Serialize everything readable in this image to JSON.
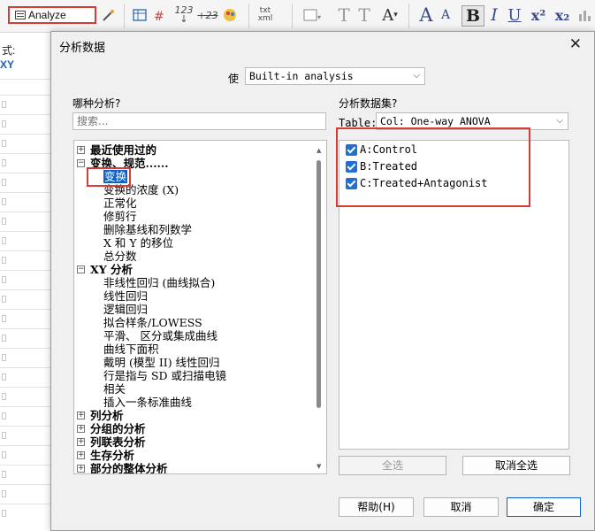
{
  "toolbar": {
    "analyze_label": "Analyze",
    "tool_glyphs": {
      "superscript": "x²",
      "subscript": "x₂",
      "numbers": "123",
      "numbers2": "+23",
      "bold": "B",
      "italic": "I",
      "underline": "U",
      "big_a": "A",
      "small_a": "A",
      "t1": "T",
      "t2": "T",
      "text_menu": "A",
      "txt_xml": "txt xml"
    }
  },
  "sheet": {
    "format_label": "式:",
    "xy_label": "XY"
  },
  "dialog": {
    "title": "分析数据",
    "close_glyph": "✕",
    "use_label": "使",
    "analysis_source": {
      "value": "Built-in analysis",
      "arrow": "⌵"
    },
    "which_analysis_label": "哪种分析?",
    "search": {
      "placeholder": "搜索..."
    },
    "tree": [
      {
        "label": "最近使用过的",
        "expander": "+"
      },
      {
        "label": "变换、规范......",
        "expander": "−"
      },
      {
        "label": "变换",
        "selected": true
      },
      {
        "label": "变换的浓度 (X)"
      },
      {
        "label": "正常化"
      },
      {
        "label": "修剪行"
      },
      {
        "label": "删除基线和列数学"
      },
      {
        "label": "X 和 Y 的移位"
      },
      {
        "label": "总分数"
      },
      {
        "label": "XY 分析",
        "expander": "−"
      },
      {
        "label": "非线性回归 (曲线拟合)"
      },
      {
        "label": "线性回归"
      },
      {
        "label": "逻辑回归"
      },
      {
        "label": "拟合样条/LOWESS"
      },
      {
        "label": "平滑、 区分或集成曲线"
      },
      {
        "label": "曲线下面积"
      },
      {
        "label": "戴明 (模型 II) 线性回归"
      },
      {
        "label": "行是指与 SD 或扫描电镜"
      },
      {
        "label": "相关"
      },
      {
        "label": "插入一条标准曲线"
      },
      {
        "label": "列分析",
        "expander": "+"
      },
      {
        "label": "分组的分析",
        "expander": "+"
      },
      {
        "label": "列联表分析",
        "expander": "+"
      },
      {
        "label": "生存分析",
        "expander": "+"
      },
      {
        "label": "部分的整体分析",
        "expander": "+"
      }
    ],
    "datasets_label": "分析数据集?",
    "table_label": "Table:",
    "table_select": {
      "value": "Col: One-way ANOVA",
      "arrow": "⌵"
    },
    "datasets": [
      {
        "label": "A:Control",
        "checked": true
      },
      {
        "label": "B:Treated",
        "checked": true
      },
      {
        "label": "C:Treated+Antagonist",
        "checked": true
      }
    ],
    "buttons": {
      "select_all": "全选",
      "deselect_all": "取消全选",
      "help": "帮助(H)",
      "cancel": "取消",
      "ok": "确定"
    }
  },
  "colors": {
    "accent": "#0a64c8",
    "highlight": "#d93a36",
    "checkbox": "#1f6fd4"
  }
}
